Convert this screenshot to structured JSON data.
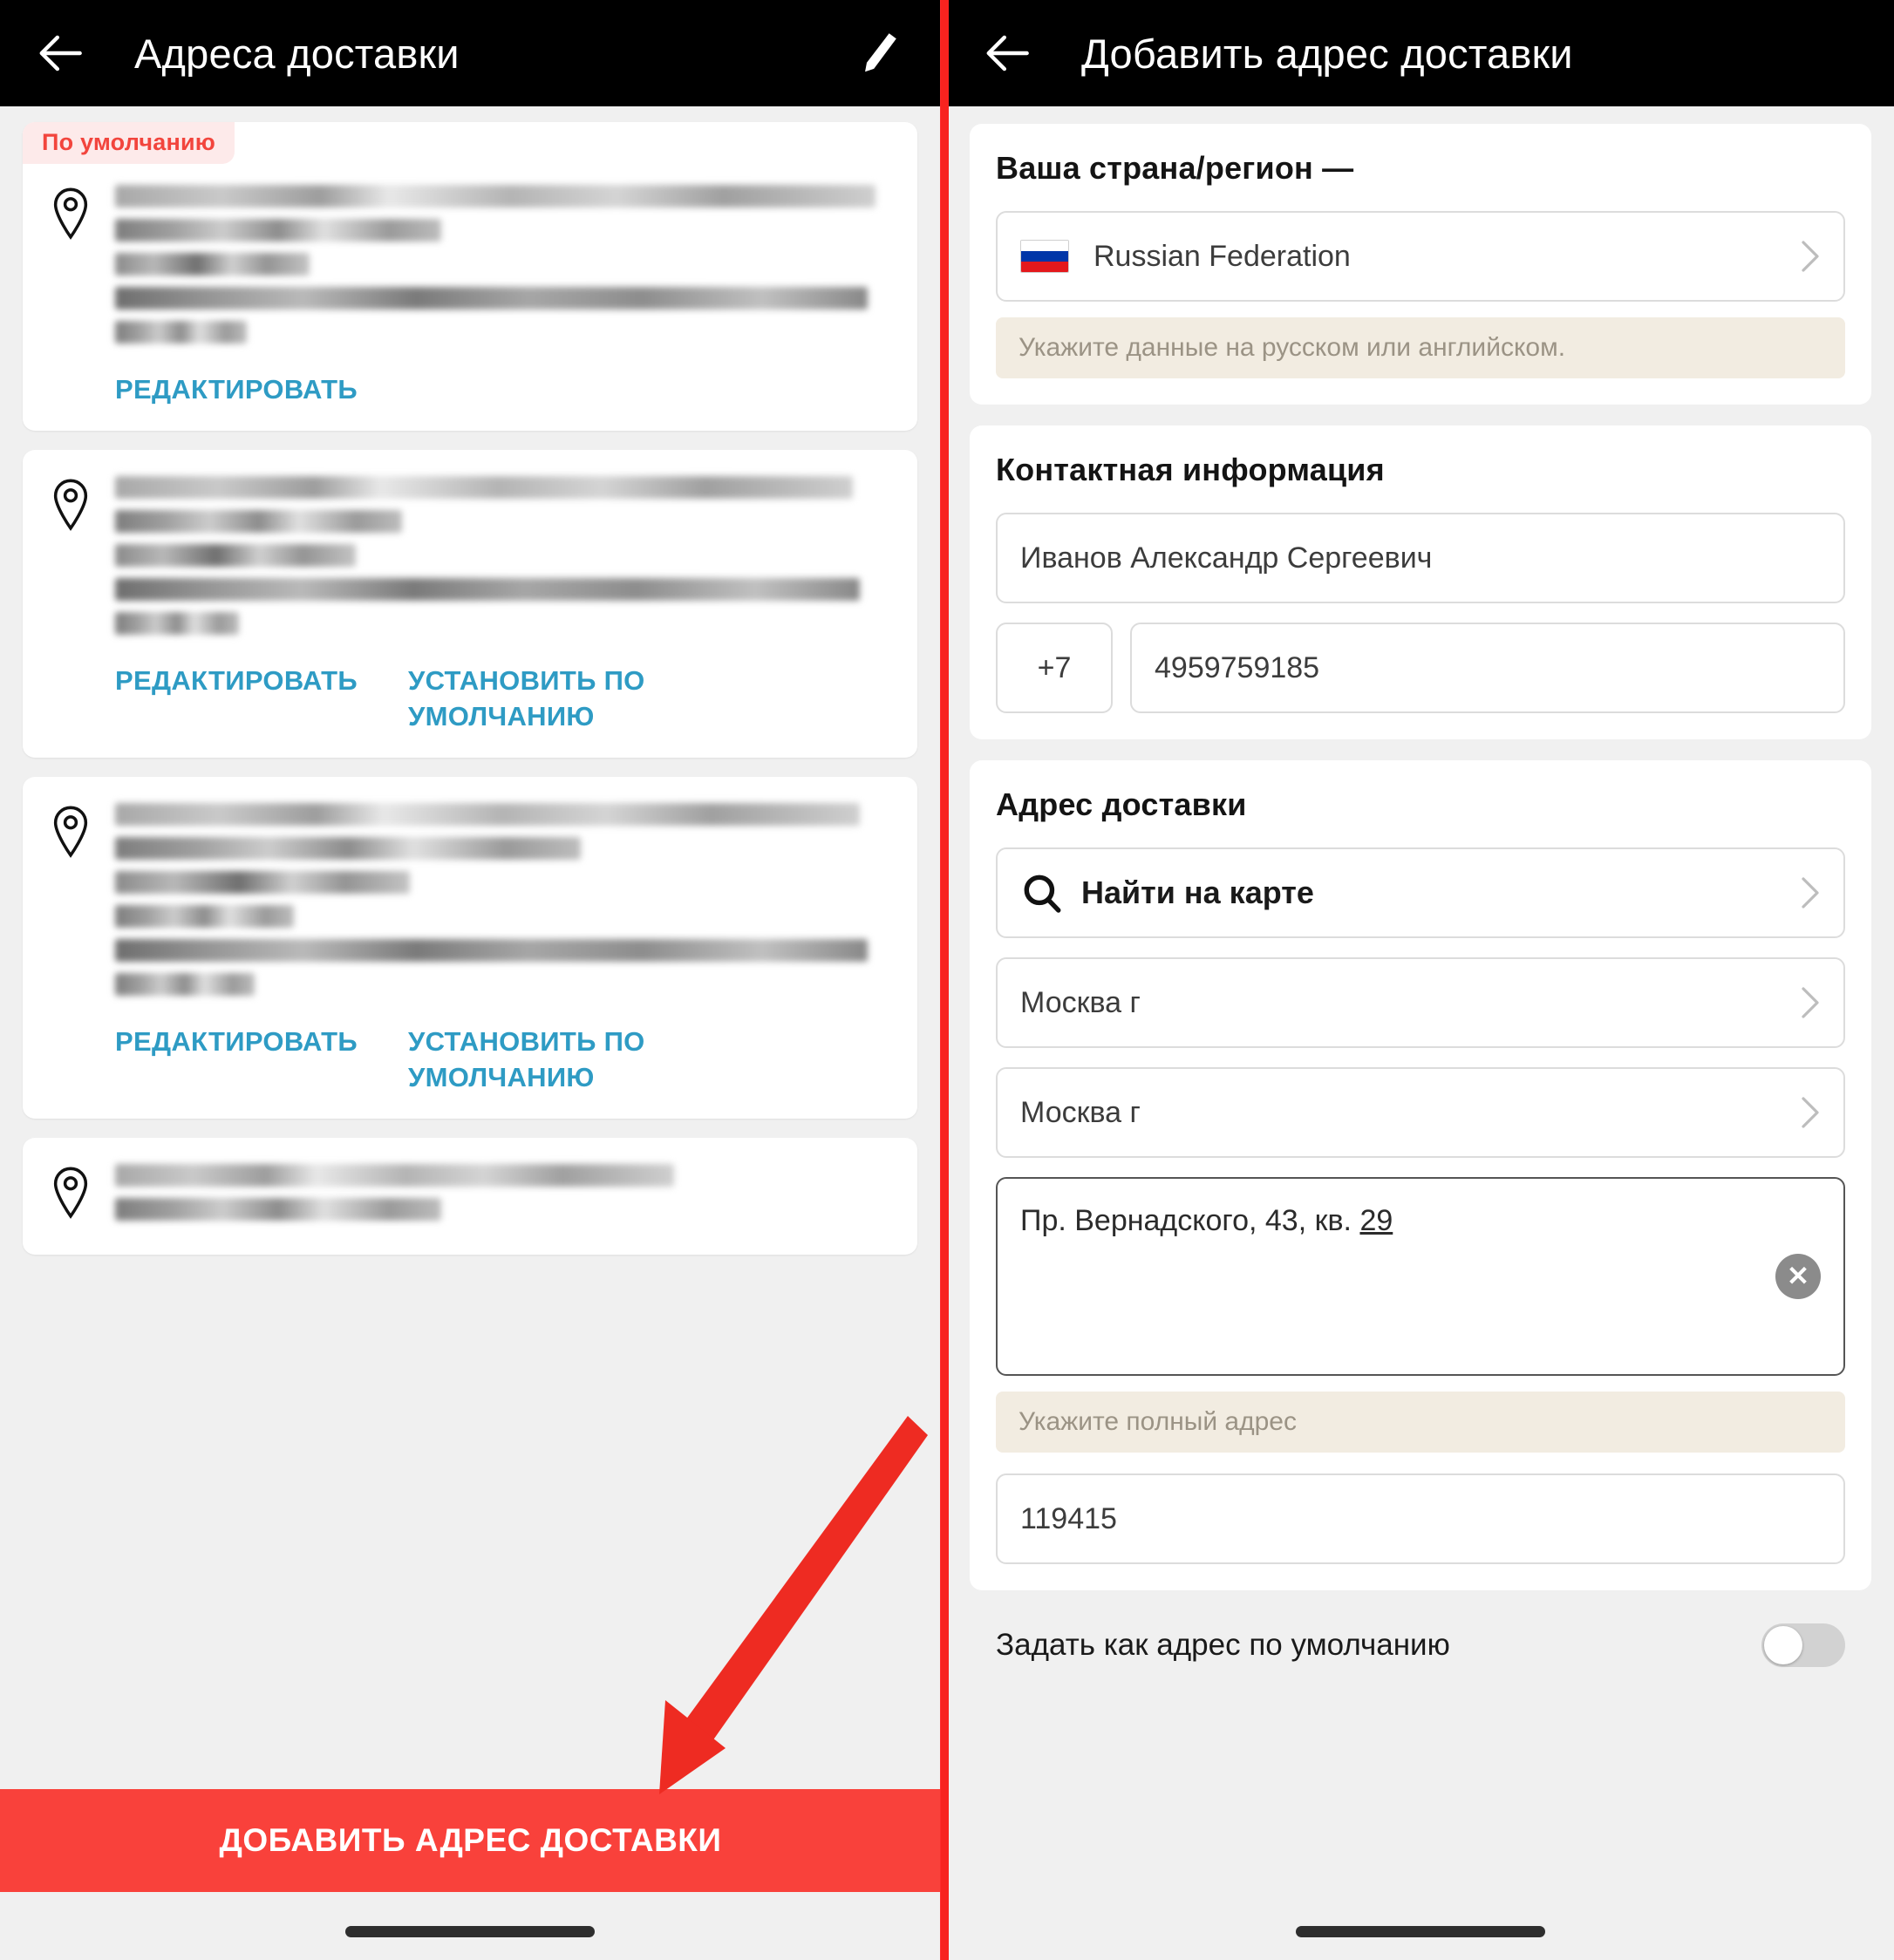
{
  "left": {
    "appbar": {
      "title": "Адреса доставки",
      "back_icon": "back-arrow-icon",
      "edit_icon": "pencil-icon"
    },
    "default_badge": "По умолчанию",
    "labels": {
      "edit": "РЕДАКТИРОВАТЬ",
      "set_default": "УСТАНОВИТЬ ПО УМОЛЧАНИЮ"
    },
    "cards": [
      {
        "has_badge": true,
        "has_set_default": false,
        "line_count": 6
      },
      {
        "has_badge": false,
        "has_set_default": true,
        "line_count": 6
      },
      {
        "has_badge": false,
        "has_set_default": true,
        "line_count": 7
      },
      {
        "has_badge": false,
        "has_set_default": false,
        "line_count": 2
      }
    ],
    "cta_label": "ДОБАВИТЬ АДРЕС ДОСТАВКИ",
    "cta_color": "#f9413b"
  },
  "right": {
    "appbar": {
      "title": "Добавить адрес доставки",
      "back_icon": "back-arrow-icon"
    },
    "country_section": {
      "title": "Ваша страна/регион —",
      "country_value": "Russian Federation",
      "flag_icon": "russia-flag-icon",
      "hint": "Укажите данные на русском или английском."
    },
    "contact_section": {
      "title": "Контактная информация",
      "name_value": "Иванов Александр Сергеевич",
      "phone_code": "+7",
      "phone_value": "4959759185"
    },
    "address_section": {
      "title": "Адрес доставки",
      "find_on_map": "Найти на карте",
      "search_icon": "search-icon",
      "region_value": "Москва г",
      "city_value": "Москва г",
      "street_value_prefix": "Пр. Вернадского, 43, кв. ",
      "street_value_suffix": "29",
      "clear_icon": "clear-circle-icon",
      "street_hint": "Укажите полный адрес",
      "zip_value": "119415"
    },
    "default_toggle": {
      "label": "Задать как адрес по умолчанию",
      "state": "off"
    }
  },
  "annotation": {
    "arrow_color": "#ee2b22",
    "arrow_icon": "red-arrow-icon"
  },
  "colors": {
    "accent_link": "#2e9bc4",
    "brand_red": "#f9413b",
    "badge_bg": "#fdeaea",
    "badge_text": "#f2453d",
    "hint_bg": "#f2ece1"
  }
}
